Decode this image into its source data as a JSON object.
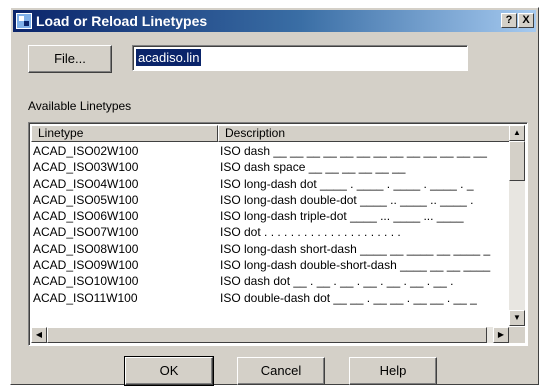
{
  "window": {
    "title": "Load or Reload Linetypes",
    "help_btn": "?",
    "close_btn": "X"
  },
  "file": {
    "button_label": "File...",
    "path_value": "acadiso.lin"
  },
  "available_label": "Available Linetypes",
  "table": {
    "columns": [
      "Linetype",
      "Description"
    ],
    "rows": [
      {
        "linetype": "ACAD_ISO02W100",
        "description": "ISO dash __ __ __ __ __ __ __ __ __ __ __ __ __"
      },
      {
        "linetype": "ACAD_ISO03W100",
        "description": "ISO dash space __    __    __    __    __    __"
      },
      {
        "linetype": "ACAD_ISO04W100",
        "description": "ISO long-dash dot ____ . ____ . ____ . ____ . _"
      },
      {
        "linetype": "ACAD_ISO05W100",
        "description": "ISO long-dash double-dot ____ .. ____ .. ____ ."
      },
      {
        "linetype": "ACAD_ISO06W100",
        "description": "ISO long-dash triple-dot ____ ... ____ ... ____"
      },
      {
        "linetype": "ACAD_ISO07W100",
        "description": "ISO dot . . . . . . . . . . . . . . . . . . . . ."
      },
      {
        "linetype": "ACAD_ISO08W100",
        "description": "ISO long-dash short-dash ____ __ ____ __ ____ _"
      },
      {
        "linetype": "ACAD_ISO09W100",
        "description": "ISO long-dash double-short-dash ____ __ __ ____"
      },
      {
        "linetype": "ACAD_ISO10W100",
        "description": "ISO dash dot __ . __ . __ . __ . __ . __ . __ ."
      },
      {
        "linetype": "ACAD_ISO11W100",
        "description": "ISO double-dash dot __ __ . __ __ . __ __ . __ _"
      }
    ]
  },
  "scroll": {
    "up": "▲",
    "down": "▼",
    "left": "◀",
    "right": "▶"
  },
  "buttons": {
    "ok": "OK",
    "cancel": "Cancel",
    "help": "Help"
  }
}
